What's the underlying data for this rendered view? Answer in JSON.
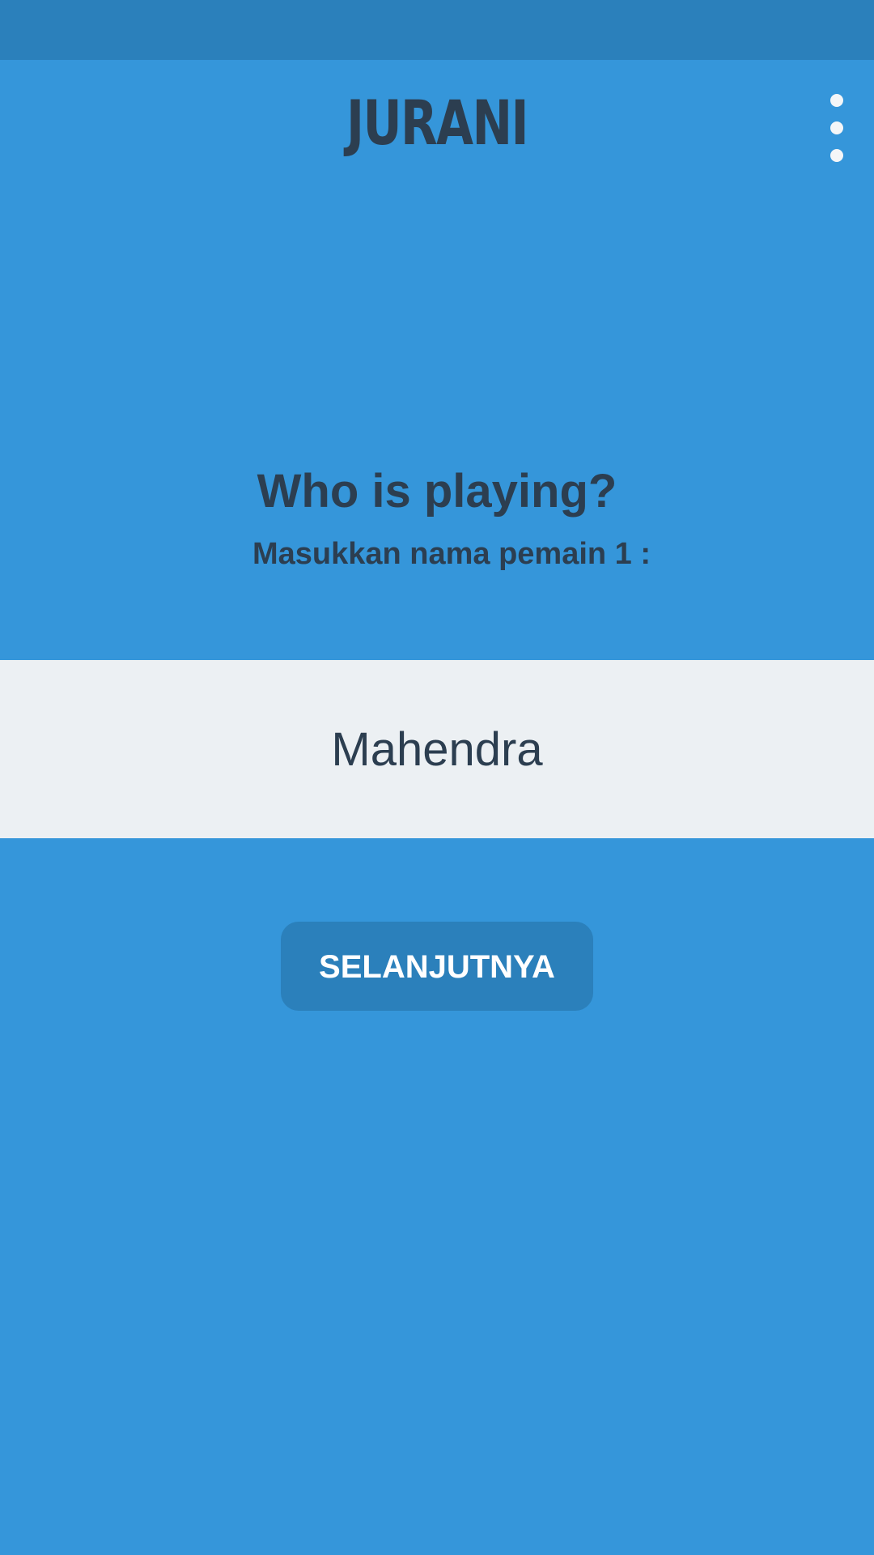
{
  "app": {
    "title": "JURANI"
  },
  "menu": {
    "icon": "more-vertical-icon"
  },
  "main": {
    "headline": "Who is playing?",
    "prompt": "Masukkan nama pemain  1 :",
    "name_input_value": "Mahendra",
    "next_button_label": "SELANJUTNYA"
  },
  "colors": {
    "background": "#3596da",
    "status_bar": "#2b80bb",
    "text_dark": "#2c3e50",
    "input_background": "#ecf0f3",
    "button_background": "#2b80bb",
    "button_text": "#ffffff"
  }
}
